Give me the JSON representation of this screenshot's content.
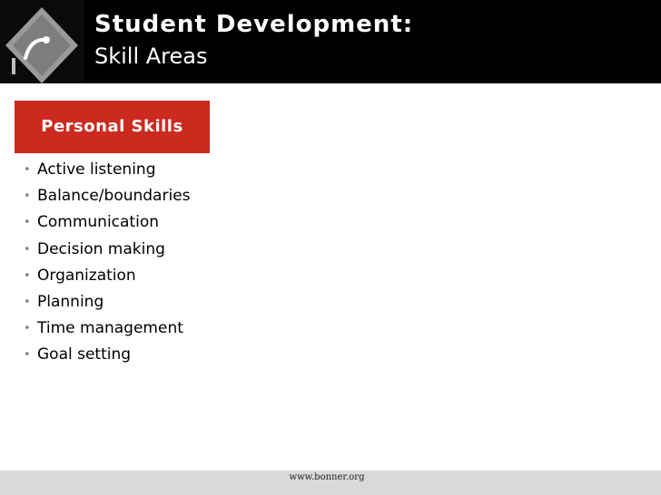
{
  "header": {
    "title": "Student Development:",
    "subtitle": "Skill Areas",
    "logo_icon": "curved-arrow-diamond-logo"
  },
  "section": {
    "label": "Personal Skills",
    "color": "#cc2a1f"
  },
  "skills": [
    "Active listening",
    "Balance/boundaries",
    "Communication",
    "Decision making",
    "Organization",
    "Planning",
    "Time management",
    "Goal setting"
  ],
  "footer": {
    "url": "www.bonner.org"
  }
}
